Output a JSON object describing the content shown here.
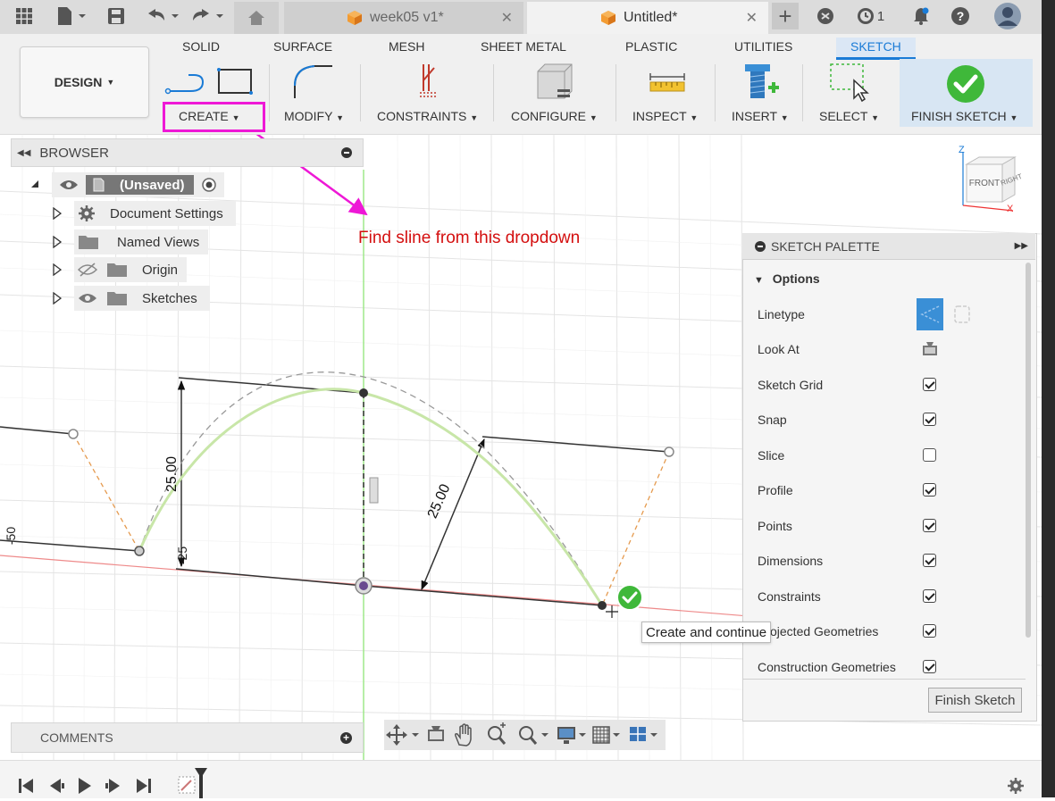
{
  "tabs": [
    {
      "label": "week05 v1*"
    },
    {
      "label": "Untitled*"
    }
  ],
  "job_count": "1",
  "ribbon_tabs": [
    "SOLID",
    "SURFACE",
    "MESH",
    "SHEET METAL",
    "PLASTIC",
    "UTILITIES",
    "SKETCH"
  ],
  "design_button": "DESIGN",
  "groups": {
    "create": "CREATE",
    "modify": "MODIFY",
    "constraints": "CONSTRAINTS",
    "configure": "CONFIGURE",
    "inspect": "INSPECT",
    "insert": "INSERT",
    "select": "SELECT",
    "finish": "FINISH SKETCH"
  },
  "browser": {
    "title": "BROWSER",
    "root": "(Unsaved)",
    "items": [
      "Document Settings",
      "Named Views",
      "Origin",
      "Sketches"
    ]
  },
  "annotation": "Find sline from this dropdown",
  "sketch_dims": {
    "dim_a": "25.00",
    "dim_b": "25.00",
    "axis_a": "-50",
    "axis_b": "-25"
  },
  "viewcube": {
    "front": "FRONT",
    "right": "RIGHT",
    "z": "Z",
    "x": "X"
  },
  "palette": {
    "title": "SKETCH PALETTE",
    "section": "Options",
    "rows": [
      {
        "label": "Linetype"
      },
      {
        "label": "Look At"
      },
      {
        "label": "Sketch Grid",
        "checked": true
      },
      {
        "label": "Snap",
        "checked": true
      },
      {
        "label": "Slice",
        "checked": false
      },
      {
        "label": "Profile",
        "checked": true
      },
      {
        "label": "Points",
        "checked": true
      },
      {
        "label": "Dimensions",
        "checked": true
      },
      {
        "label": "Constraints",
        "checked": true
      },
      {
        "label": "Projected Geometries",
        "checked": true
      },
      {
        "label": "Construction Geometries",
        "checked": true
      }
    ],
    "finish_button": "Finish Sketch"
  },
  "tooltip": "Create and continue",
  "comments": "COMMENTS",
  "colors": {
    "accent": "#1a7bd6",
    "highlight": "#ee18d6",
    "annotation": "#d40f0f",
    "finish_green": "#3fb83a"
  }
}
